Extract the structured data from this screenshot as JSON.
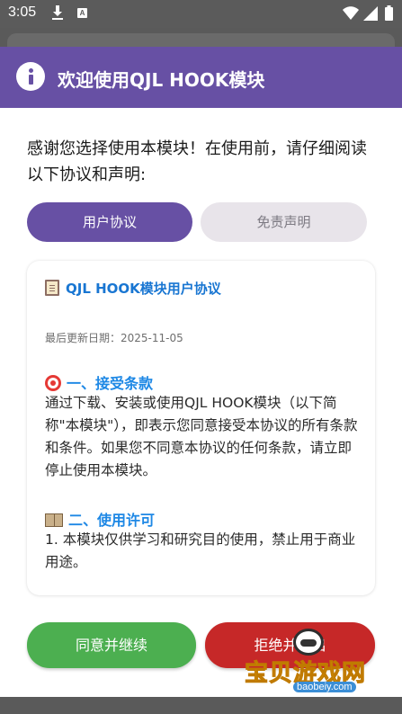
{
  "status_bar": {
    "time": "3:05",
    "notification_icons": [
      "download-icon",
      "a-badge-icon"
    ],
    "system_icons": [
      "wifi-icon",
      "signal-icon",
      "battery-icon"
    ],
    "badge_letter": "A"
  },
  "dialog": {
    "title": "欢迎使用QJL HOOK模块",
    "header_color": "#6750a4",
    "intro": "感谢您选择使用本模块！在使用前，请仔细阅读以下协议和声明:",
    "tabs": [
      {
        "label": "用户协议",
        "selected": true
      },
      {
        "label": "免责声明",
        "selected": false
      }
    ],
    "document": {
      "title_icon": "clipboard-icon",
      "title": "QJL HOOK模块用户协议",
      "updated": "最后更新日期：2025-11-05",
      "sections": [
        {
          "icon": "target-icon",
          "title": "一、接受条款",
          "body": "通过下载、安装或使用QJL HOOK模块（以下简称\"本模块\"），即表示您同意接受本协议的所有条款和条件。如果您不同意本协议的任何条款，请立即停止使用本模块。"
        },
        {
          "icon": "book-icon",
          "title": "二、使用许可",
          "body": "1. 本模块仅供学习和研究目的使用，禁止用于商业用途。"
        }
      ]
    },
    "buttons": {
      "agree": "同意并继续",
      "reject": "拒绝并退出"
    },
    "colors": {
      "agree": "#4caf50",
      "reject": "#c62828",
      "section_title": "#1e88e5"
    }
  },
  "watermark": {
    "text": "宝贝游戏网",
    "url": "baobeiy.com"
  }
}
